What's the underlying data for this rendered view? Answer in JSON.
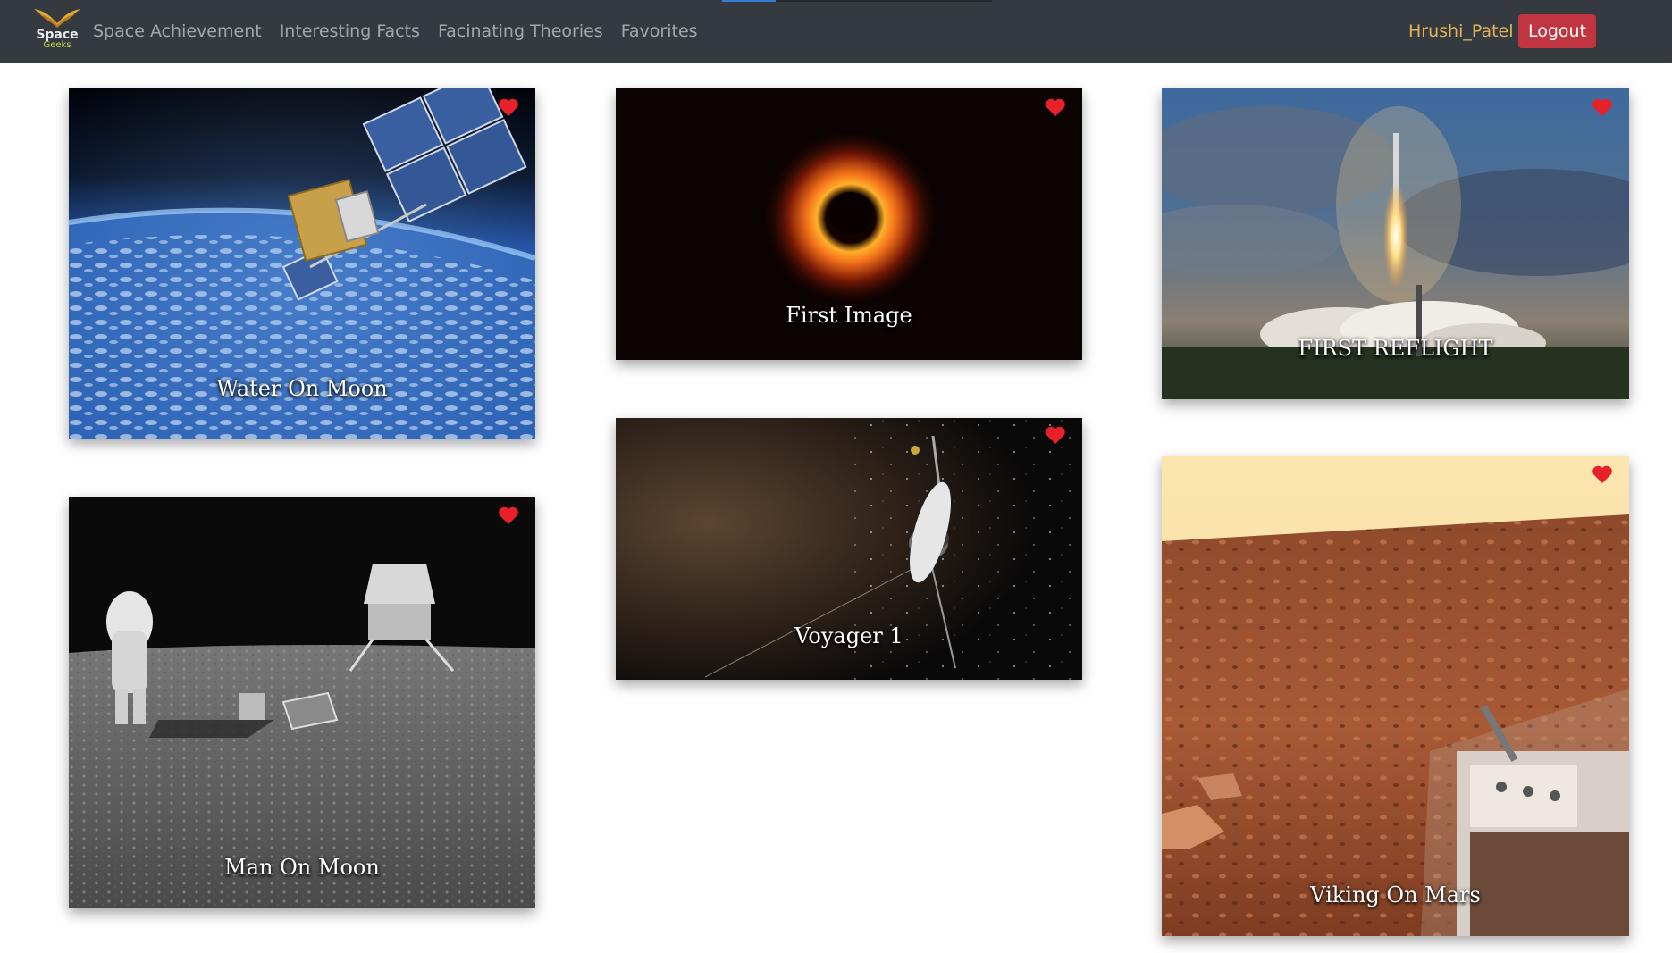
{
  "brand": {
    "line1": "Space",
    "line2": "Geeks"
  },
  "nav": {
    "links": [
      "Space Achievement",
      "Interesting Facts",
      "Facinating Theories",
      "Favorites"
    ],
    "user": "Hrushi_Patel",
    "logout_label": "Logout"
  },
  "cards": [
    {
      "title": "Water On Moon"
    },
    {
      "title": "First Image"
    },
    {
      "title": "FIRST REFLIGHT"
    },
    {
      "title": "Man On Moon"
    },
    {
      "title": "Voyager 1"
    },
    {
      "title": "Viking On Mars"
    }
  ],
  "colors": {
    "navbar_bg": "#343a40",
    "user_name": "#e0b457",
    "logout_bg": "#c0353f",
    "heart": "#e8202a"
  },
  "icons": {
    "brand": "winged-logo-icon",
    "favorite": "heart-icon"
  }
}
